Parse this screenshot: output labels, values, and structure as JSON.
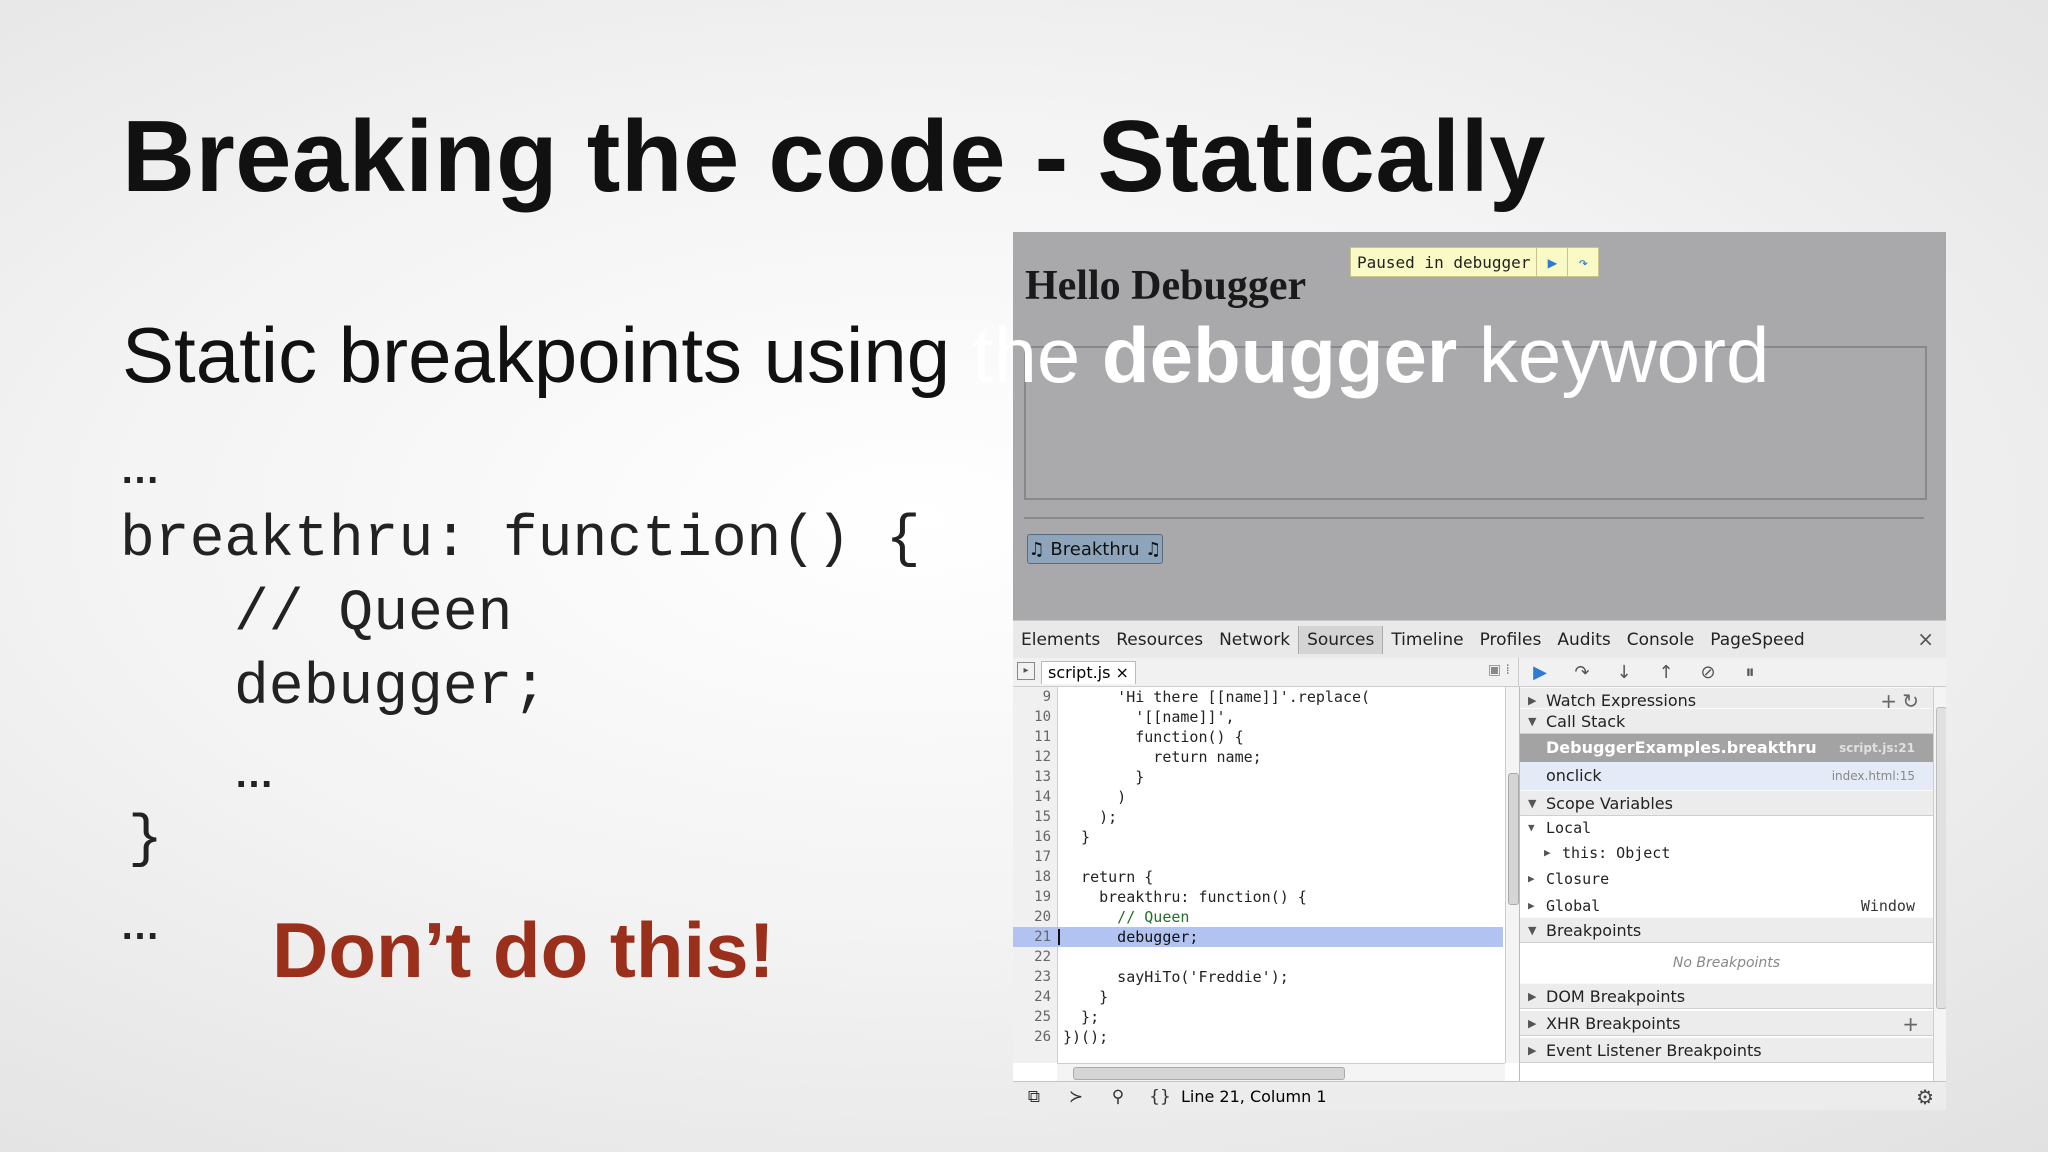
{
  "slide": {
    "title": "Breaking the code - Statically",
    "subtitle_part1": "Static breakpoints using ",
    "subtitle_part2": "the ",
    "subtitle_bold": "debugger",
    "subtitle_part3": " keyword",
    "code": {
      "ellipsis_top": "…",
      "line1": "breakthru: function() {",
      "line2": "// Queen",
      "line3": "debugger;",
      "ellipsis_inner": "…",
      "close_brace": "}",
      "ellipsis_bottom": "…"
    },
    "warning": "Don’t do this!",
    "warning_color": "#9a2f1b"
  },
  "browser_page": {
    "heading": "Hello Debugger",
    "paused_label": "Paused in debugger",
    "button_label": "♫ Breakthru ♫"
  },
  "devtools": {
    "tabs": [
      "Elements",
      "Resources",
      "Network",
      "Sources",
      "Timeline",
      "Profiles",
      "Audits",
      "Console",
      "PageSpeed"
    ],
    "active_tab": "Sources",
    "close": "×",
    "file_tab": "script.js ×",
    "code_lines": [
      {
        "n": "9",
        "code": "      'Hi there [[name]]'.replace("
      },
      {
        "n": "10",
        "code": "        '[[name]]',"
      },
      {
        "n": "11",
        "code": "        function() {"
      },
      {
        "n": "12",
        "code": "          return name;"
      },
      {
        "n": "13",
        "code": "        }"
      },
      {
        "n": "14",
        "code": "      )"
      },
      {
        "n": "15",
        "code": "    );"
      },
      {
        "n": "16",
        "code": "  }"
      },
      {
        "n": "17",
        "code": ""
      },
      {
        "n": "18",
        "code": "  return {"
      },
      {
        "n": "19",
        "code": "    breakthru: function() {"
      },
      {
        "n": "20",
        "code": "      // Queen"
      },
      {
        "n": "21",
        "code": "      debugger;"
      },
      {
        "n": "22",
        "code": ""
      },
      {
        "n": "23",
        "code": "      sayHiTo('Freddie');"
      },
      {
        "n": "24",
        "code": "    }"
      },
      {
        "n": "25",
        "code": "  };"
      },
      {
        "n": "26",
        "code": "})();"
      }
    ],
    "highlight_line": "21",
    "status_text": "Line 21, Column 1",
    "sidebar": {
      "watch": "Watch Expressions",
      "call_stack": "Call Stack",
      "stack_frames": [
        {
          "name": "DebuggerExamples.breakthru",
          "loc": "script.js:21"
        },
        {
          "name": "onclick",
          "loc": "index.html:15"
        }
      ],
      "scope": "Scope Variables",
      "local": "Local",
      "this_obj": "this: Object",
      "closure": "Closure",
      "global": "Global",
      "global_val": "Window",
      "breakpoints": "Breakpoints",
      "no_breakpoints": "No Breakpoints",
      "dom_bp": "DOM Breakpoints",
      "xhr_bp": "XHR Breakpoints",
      "event_bp": "Event Listener Breakpoints"
    }
  }
}
